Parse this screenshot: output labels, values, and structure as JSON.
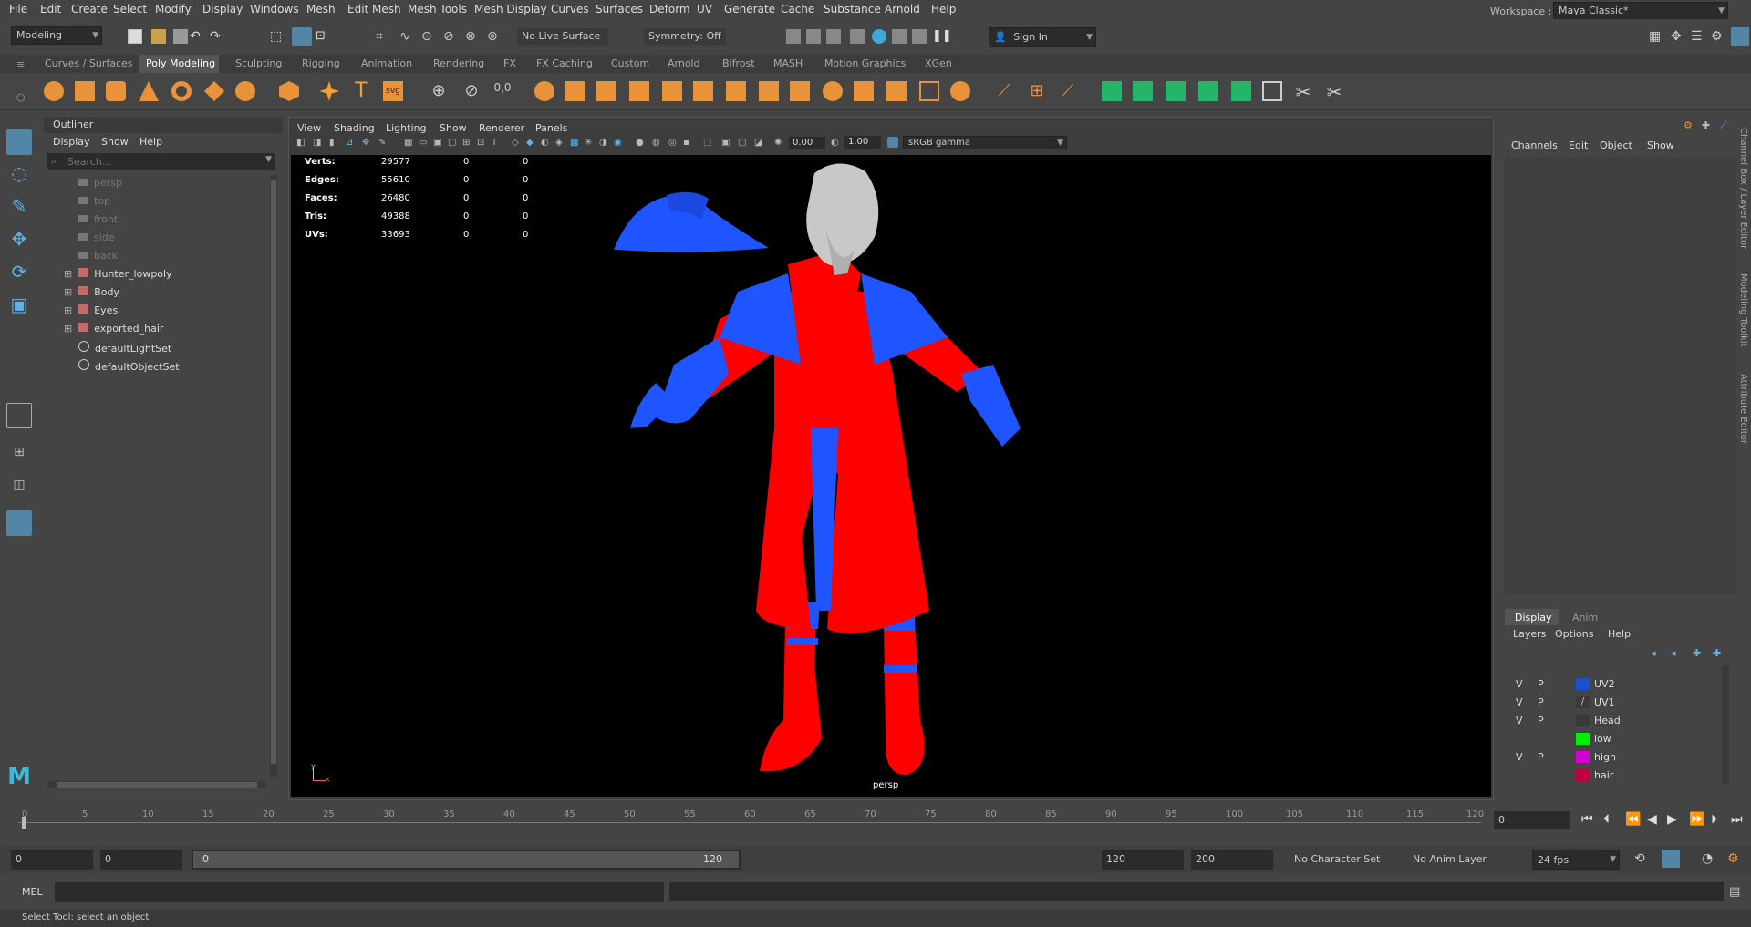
{
  "menubar": {
    "items": [
      "File",
      "Edit",
      "Create",
      "Select",
      "Modify",
      "Display",
      "Windows",
      "Mesh",
      "Edit Mesh",
      "Mesh Tools",
      "Mesh Display",
      "Curves",
      "Surfaces",
      "Deform",
      "UV",
      "Generate",
      "Cache",
      "Substance",
      "Arnold",
      "Help"
    ],
    "workspace_label": "Workspace :",
    "workspace_value": "Maya Classic*"
  },
  "statusline": {
    "mode": "Modeling",
    "live_surface": "No Live Surface",
    "symmetry": "Symmetry: Off",
    "sign_in": "Sign In"
  },
  "shelf_tabs": [
    "Curves / Surfaces",
    "Poly Modeling",
    "Sculpting",
    "Rigging",
    "Animation",
    "Rendering",
    "FX",
    "FX Caching",
    "Custom",
    "Arnold",
    "Bifrost",
    "MASH",
    "Motion Graphics",
    "XGen"
  ],
  "shelf_active_tab": "Poly Modeling",
  "outliner": {
    "title": "Outliner",
    "menu": [
      "Display",
      "Show",
      "Help"
    ],
    "search_placeholder": "Search...",
    "items": [
      {
        "label": "persp",
        "kind": "camera",
        "dim": true
      },
      {
        "label": "top",
        "kind": "camera",
        "dim": true
      },
      {
        "label": "front",
        "kind": "camera",
        "dim": true
      },
      {
        "label": "side",
        "kind": "camera",
        "dim": true
      },
      {
        "label": "back",
        "kind": "camera",
        "dim": true
      },
      {
        "label": "Hunter_lowpoly",
        "kind": "mesh",
        "dim": false
      },
      {
        "label": "Body",
        "kind": "mesh",
        "dim": false
      },
      {
        "label": "Eyes",
        "kind": "mesh",
        "dim": false
      },
      {
        "label": "exported_hair",
        "kind": "mesh",
        "dim": false
      },
      {
        "label": "defaultLightSet",
        "kind": "set",
        "dim": false
      },
      {
        "label": "defaultObjectSet",
        "kind": "set",
        "dim": false
      }
    ]
  },
  "viewport": {
    "menu": [
      "View",
      "Shading",
      "Lighting",
      "Show",
      "Renderer",
      "Panels"
    ],
    "exposure": "0.00",
    "gamma": "1.00",
    "color_space": "sRGB gamma",
    "camera_label": "persp",
    "hud": [
      {
        "label": "Verts:",
        "a": "29577",
        "b": "0",
        "c": "0"
      },
      {
        "label": "Edges:",
        "a": "55610",
        "b": "0",
        "c": "0"
      },
      {
        "label": "Faces:",
        "a": "26480",
        "b": "0",
        "c": "0"
      },
      {
        "label": "Tris:",
        "a": "49388",
        "b": "0",
        "c": "0"
      },
      {
        "label": "UVs:",
        "a": "33693",
        "b": "0",
        "c": "0"
      }
    ],
    "colors": {
      "coat_red": "#ff0000",
      "coat_blue": "#1f55ff",
      "hair_gray": "#c8c8c8"
    }
  },
  "channel_box": {
    "menu": [
      "Channels",
      "Edit",
      "Object",
      "Show"
    ],
    "side_tabs": [
      "Channel Box / Layer Editor",
      "Modeling Toolkit",
      "Attribute Editor"
    ]
  },
  "layer_editor": {
    "tabs": [
      "Display",
      "Anim"
    ],
    "menu": [
      "Layers",
      "Options",
      "Help"
    ],
    "layers": [
      {
        "v": "V",
        "p": "P",
        "name": "UV2",
        "color": "#1a4fd0"
      },
      {
        "v": "V",
        "p": "P",
        "name": "UV1",
        "color": ""
      },
      {
        "v": "V",
        "p": "P",
        "name": "Head",
        "color": ""
      },
      {
        "v": "",
        "p": "",
        "name": "low",
        "color": "#00ee00"
      },
      {
        "v": "V",
        "p": "P",
        "name": "high",
        "color": "#d000d0"
      },
      {
        "v": "",
        "p": "",
        "name": "hair",
        "color": "#c0003a"
      }
    ]
  },
  "timeline": {
    "ticks": [
      "0",
      "5",
      "10",
      "15",
      "20",
      "25",
      "30",
      "35",
      "40",
      "45",
      "50",
      "55",
      "60",
      "65",
      "70",
      "75",
      "80",
      "85",
      "90",
      "95",
      "100",
      "105",
      "110",
      "115",
      "120"
    ],
    "current_frame": "0"
  },
  "range": {
    "start": "0",
    "playback_start": "0",
    "slider_start": "0",
    "slider_end": "120",
    "playback_end": "120",
    "end": "200",
    "character_set": "No Character Set",
    "anim_layer": "No Anim Layer",
    "fps": "24 fps"
  },
  "command_line": {
    "label": "MEL"
  },
  "help_line": {
    "text": "Select Tool: select an object"
  }
}
